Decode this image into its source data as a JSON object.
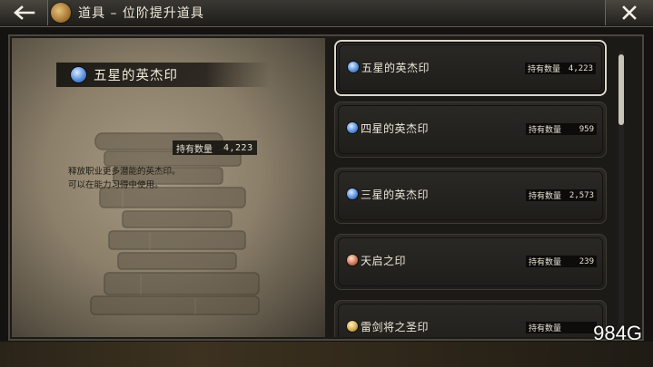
{
  "header": {
    "title": "道具 – 位阶提升道具",
    "back_icon": "arrow-left-icon",
    "close_icon": "close-icon"
  },
  "detail": {
    "name": "五星的英杰印",
    "qty_label": "持有数量",
    "qty_value": "4,223",
    "description": [
      "释放职业更多潜能的英杰印。",
      "可以在能力习得中使用。"
    ],
    "gem_color": "blue"
  },
  "items": [
    {
      "name": "五星的英杰印",
      "qty_label": "持有数量",
      "qty": "4,223",
      "gem": "blue",
      "selected": true
    },
    {
      "name": "四星的英杰印",
      "qty_label": "持有数量",
      "qty": "959",
      "gem": "blue",
      "selected": false
    },
    {
      "name": "三星的英杰印",
      "qty_label": "持有数量",
      "qty": "2,573",
      "gem": "blue",
      "selected": false
    },
    {
      "name": "天启之印",
      "qty_label": "持有数量",
      "qty": "239",
      "gem": "copper",
      "selected": false
    },
    {
      "name": "雷剑将之圣印",
      "qty_label": "持有数量",
      "qty": "",
      "gem": "gold",
      "selected": false
    }
  ],
  "scroll": {
    "position": 0.0
  },
  "watermark": "984G",
  "colors": {
    "accent_blue": "#5a90e0",
    "panel": "#1f1d1a",
    "parchment": "#a79a83"
  }
}
